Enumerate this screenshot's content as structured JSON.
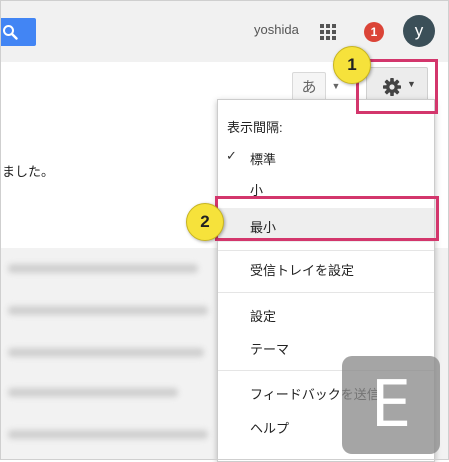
{
  "header": {
    "username": "yoshida",
    "notification_count": "1",
    "avatar_letter": "y"
  },
  "toolbar": {
    "ime_label": "あ"
  },
  "list": {
    "visible_message": "ました。"
  },
  "menu": {
    "heading": "表示間隔:",
    "density_options": [
      {
        "label": "標準",
        "checked": true
      },
      {
        "label": "小",
        "checked": false
      },
      {
        "label": "最小",
        "checked": false
      }
    ],
    "items": [
      "受信トレイを設定",
      "設定",
      "テーマ",
      "フィードバックを送信",
      "ヘルプ"
    ]
  },
  "annotations": {
    "step1": "1",
    "step2": "2"
  },
  "watermark": "E",
  "colors": {
    "highlight": "#d3366c",
    "badge": "#f6e23b",
    "primary_blue": "#4285f4",
    "notification_red": "#db4437"
  },
  "icons": [
    "search-icon",
    "apps-grid-icon",
    "gear-icon",
    "caret-down-icon",
    "checkmark-icon"
  ]
}
